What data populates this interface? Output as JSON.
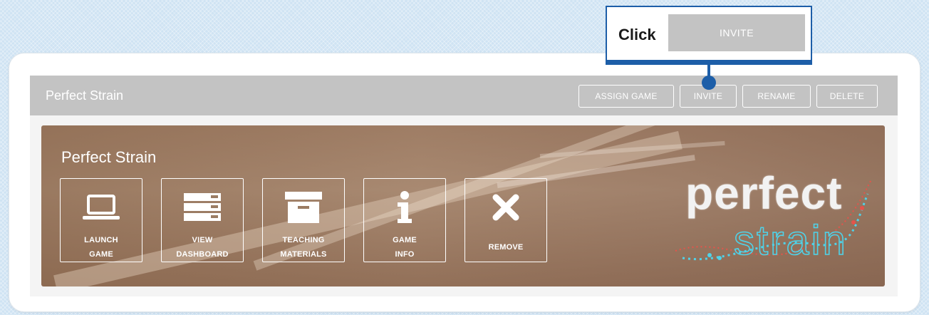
{
  "callout": {
    "click_text": "Click",
    "button_label": "INVITE"
  },
  "panel": {
    "title": "Perfect Strain",
    "actions": [
      {
        "label": "ASSIGN GAME"
      },
      {
        "label": "INVITE"
      },
      {
        "label": "RENAME"
      },
      {
        "label": "DELETE"
      }
    ]
  },
  "banner": {
    "title": "Perfect Strain",
    "tiles": [
      {
        "label": "LAUNCH\nGAME",
        "icon": "laptop-icon"
      },
      {
        "label": "VIEW\nDASHBOARD",
        "icon": "dashboard-icon"
      },
      {
        "label": "TEACHING\nMATERIALS",
        "icon": "archive-box-icon"
      },
      {
        "label": "GAME\nINFO",
        "icon": "info-icon"
      },
      {
        "label": "REMOVE",
        "icon": "close-icon"
      }
    ],
    "logo": {
      "word1": "perfect",
      "word2": "strain"
    }
  },
  "colors": {
    "accent": "#1d5ea8",
    "header_gray": "#c3c3c3",
    "logo_cyan": "#4fd2e8",
    "logo_red": "#e5534b"
  }
}
